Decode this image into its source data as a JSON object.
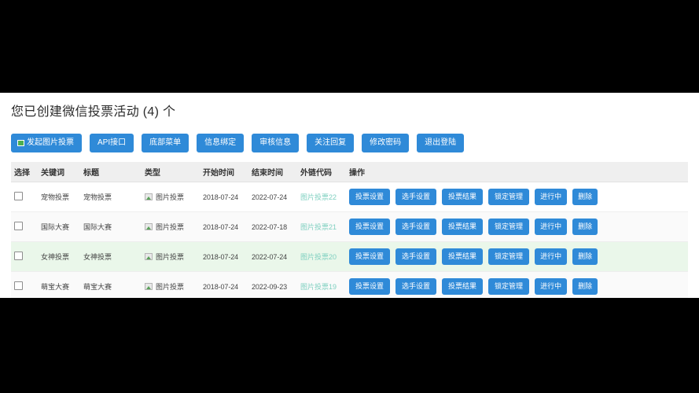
{
  "page": {
    "title": "您已创建微信投票活动 (4) 个",
    "accent_color": "#2f8ad8",
    "header_bg": "#efefef",
    "highlight_row_bg": "#eaf7ea",
    "link_color": "#7fd0c0"
  },
  "toolbar": {
    "buttons": [
      {
        "label": "发起图片投票",
        "icon": "flag-icon"
      },
      {
        "label": "API接口",
        "icon": ""
      },
      {
        "label": "底部菜单",
        "icon": ""
      },
      {
        "label": "信息绑定",
        "icon": ""
      },
      {
        "label": "审核信息",
        "icon": ""
      },
      {
        "label": "关注回复",
        "icon": ""
      },
      {
        "label": "修改密码",
        "icon": ""
      },
      {
        "label": "退出登陆",
        "icon": ""
      }
    ]
  },
  "table": {
    "headers": [
      "选择",
      "关键词",
      "标题",
      "类型",
      "开始时间",
      "结束时间",
      "外链代码",
      "操作"
    ],
    "rows": [
      {
        "keyword": "宠物投票",
        "title": "宠物投票",
        "type": "图片投票",
        "start": "2018-07-24",
        "end": "2022-07-24",
        "link": "图片投票22",
        "row_style": "default",
        "actions": [
          "投票设置",
          "选手设置",
          "投票结果",
          "锁定管理",
          "进行中",
          "删除"
        ]
      },
      {
        "keyword": "国际大赛",
        "title": "国际大赛",
        "type": "图片投票",
        "start": "2018-07-24",
        "end": "2022-07-18",
        "link": "图片投票21",
        "row_style": "alt",
        "actions": [
          "投票设置",
          "选手设置",
          "投票结果",
          "锁定管理",
          "进行中",
          "删除"
        ]
      },
      {
        "keyword": "女神投票",
        "title": "女神投票",
        "type": "图片投票",
        "start": "2018-07-24",
        "end": "2022-07-24",
        "link": "图片投票20",
        "row_style": "highlight",
        "actions": [
          "投票设置",
          "选手设置",
          "投票结果",
          "锁定管理",
          "进行中",
          "删除"
        ]
      },
      {
        "keyword": "萌宝大赛",
        "title": "萌宝大赛",
        "type": "图片投票",
        "start": "2018-07-24",
        "end": "2022-09-23",
        "link": "图片投票19",
        "row_style": "alt",
        "actions": [
          "投票设置",
          "选手设置",
          "投票结果",
          "锁定管理",
          "进行中",
          "删除"
        ]
      }
    ]
  }
}
